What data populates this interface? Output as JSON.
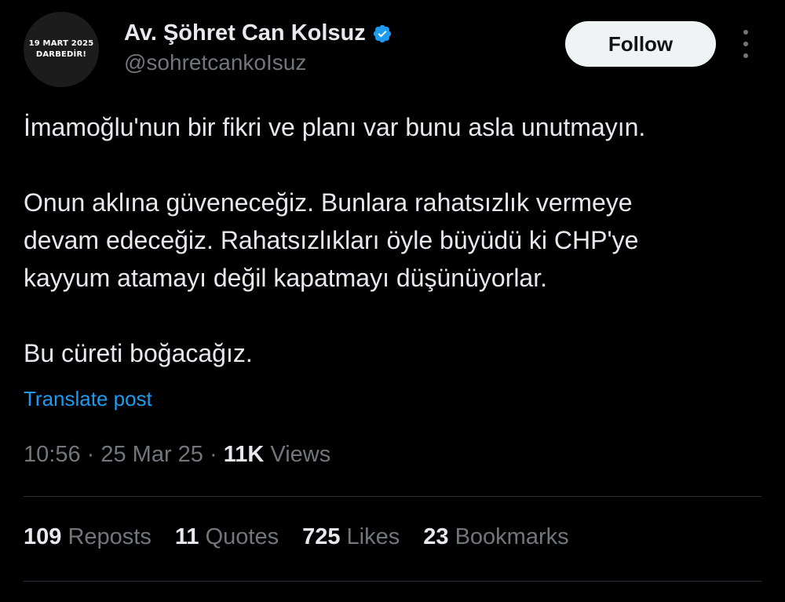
{
  "colors": {
    "background": "#000000",
    "text_primary": "#e7e9ea",
    "text_secondary": "#71767b",
    "link": "#1d9bf0",
    "verified_badge": "#1d9bf0",
    "follow_button_bg": "#eff3f4",
    "divider": "#2f3336"
  },
  "author": {
    "avatar_line1": "19 MART 2025",
    "avatar_line2": "DARBEDİR!",
    "display_name": "Av. Şöhret Can Kolsuz",
    "verified_icon": "verified-badge-icon",
    "handle": "@sohretcankoIsuz"
  },
  "actions": {
    "follow_label": "Follow",
    "more_icon": "more-options-icon"
  },
  "post": {
    "lines": [
      "İmamoğlu'nun bir fikri ve planı var bunu asla unutmayın.",
      "Onun aklına güveneceğiz. Bunlara rahatsızlık vermeye",
      "devam edeceğiz. Rahatsızlıkları öyle büyüdü ki CHP'ye",
      "kayyum atamayı değil kapatmayı düşünüyorlar.",
      "Bu cüreti boğacağız."
    ],
    "translate_label": "Translate post"
  },
  "meta": {
    "time": "10:56",
    "separator": " · ",
    "date": "25 Mar 25",
    "views_count": "11K",
    "views_label": " Views"
  },
  "stats": [
    {
      "count": "109",
      "label": "Reposts"
    },
    {
      "count": "11",
      "label": "Quotes"
    },
    {
      "count": "725",
      "label": "Likes"
    },
    {
      "count": "23",
      "label": "Bookmarks"
    }
  ]
}
